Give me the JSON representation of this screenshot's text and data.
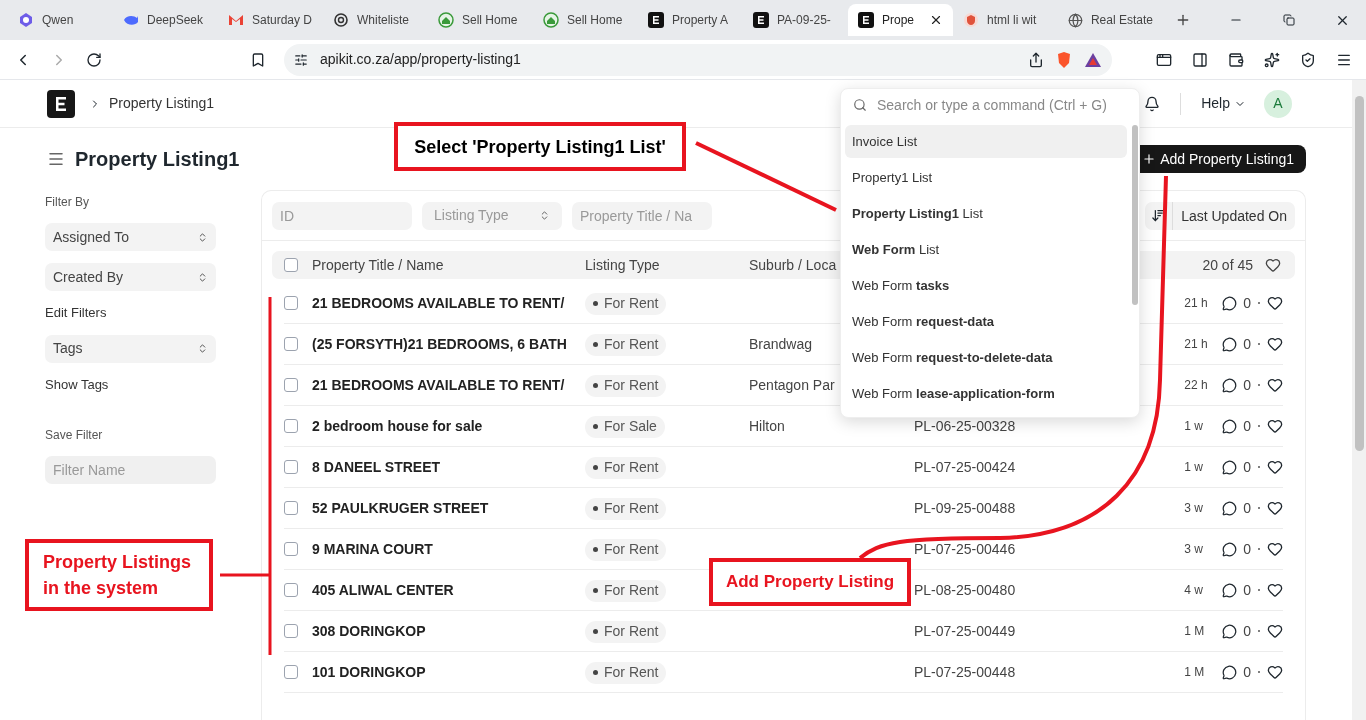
{
  "browser": {
    "tabs": [
      {
        "title": "Qwen",
        "selected": false
      },
      {
        "title": "DeepSeek",
        "selected": false
      },
      {
        "title": "Saturday D",
        "selected": false
      },
      {
        "title": "Whiteliste",
        "selected": false
      },
      {
        "title": "Sell Home",
        "selected": false
      },
      {
        "title": "Sell Home",
        "selected": false
      },
      {
        "title": "Property A",
        "selected": false
      },
      {
        "title": "PA-09-25-",
        "selected": false
      },
      {
        "title": "Prope",
        "selected": true
      },
      {
        "title": "html li wit",
        "selected": false
      },
      {
        "title": "Real Estate",
        "selected": false
      }
    ],
    "address": "apikit.co.za/app/property-listing1"
  },
  "app": {
    "breadcrumb": "Property Listing1",
    "search_placeholder": "Search or type a command (Ctrl + G)",
    "help": "Help",
    "avatar": "A"
  },
  "page": {
    "title": "Property Listing1",
    "add_button": "Add Property Listing1"
  },
  "sidebar": {
    "filter_by": "Filter By",
    "filters": [
      "Assigned To",
      "Created By"
    ],
    "edit_filters": "Edit Filters",
    "tags": "Tags",
    "show_tags": "Show Tags",
    "save_filter": "Save Filter",
    "filter_name_placeholder": "Filter Name"
  },
  "list": {
    "filters": [
      {
        "kind": "input",
        "placeholder": "ID"
      },
      {
        "kind": "select",
        "placeholder": "Listing Type"
      },
      {
        "kind": "input",
        "placeholder": "Property Title / Na"
      }
    ],
    "sort_by": "Last Updated On",
    "columns": [
      "Property Title / Name",
      "Listing Type",
      "Suburb / Loca"
    ],
    "count": "20 of 45",
    "all_checked": false,
    "rows": [
      {
        "checked": false,
        "title": "21 BEDROOMS AVAILABLE TO RENT/",
        "type": "For Rent",
        "time": "21 h",
        "comments": "0"
      },
      {
        "checked": false,
        "title": "(25 FORSYTH)21 BEDROOMS, 6 BATH",
        "type": "For Rent",
        "suburb": "Brandwag",
        "time": "21 h",
        "comments": "0"
      },
      {
        "checked": false,
        "title": "21 BEDROOMS AVAILABLE TO RENT/",
        "type": "For Rent",
        "suburb": "Pentagon Par",
        "time": "22 h",
        "comments": "0"
      },
      {
        "checked": false,
        "title": "2 bedroom house for sale",
        "type": "For Sale",
        "suburb": "Hilton",
        "id": "PL-06-25-00328",
        "time": "1 w",
        "comments": "0"
      },
      {
        "checked": false,
        "title": "8 DANEEL STREET",
        "type": "For Rent",
        "id": "PL-07-25-00424",
        "time": "1 w",
        "comments": "0"
      },
      {
        "checked": false,
        "title": "52 PAULKRUGER STREET",
        "type": "For Rent",
        "id": "PL-09-25-00488",
        "time": "3 w",
        "comments": "0"
      },
      {
        "checked": false,
        "title": "9 MARINA COURT",
        "type": "For Rent",
        "id": "PL-07-25-00446",
        "time": "3 w",
        "comments": "0"
      },
      {
        "checked": false,
        "title": "405 ALIWAL CENTER",
        "type": "For Rent",
        "id": "PL-08-25-00480",
        "time": "4 w",
        "comments": "0"
      },
      {
        "checked": false,
        "title": "308 DORINGKOP",
        "type": "For Rent",
        "id": "PL-07-25-00449",
        "time": "1 M",
        "comments": "0"
      },
      {
        "checked": false,
        "title": "101 DORINGKOP",
        "type": "For Rent",
        "id": "PL-07-25-00448",
        "time": "1 M",
        "comments": "0"
      }
    ]
  },
  "command_menu": [
    {
      "text": "Invoice List",
      "selected": true
    },
    {
      "text": "Property1 List",
      "selected": false
    },
    {
      "text": "**Property Listing1** List",
      "selected": false
    },
    {
      "text": "**Web Form** List",
      "selected": false
    },
    {
      "text": "Web Form **tasks**",
      "selected": false
    },
    {
      "text": "Web Form **request-data**",
      "selected": false
    },
    {
      "text": "Web Form **request-to-delete-data**",
      "selected": false
    },
    {
      "text": "Web Form **lease-application-form**",
      "selected": false
    }
  ],
  "annotations": [
    {
      "kind": "callout",
      "text": "Select 'Property Listing1 List'"
    },
    {
      "kind": "label",
      "text": "Property Listings in the system"
    },
    {
      "kind": "label",
      "text": "Add Property Listing"
    }
  ]
}
